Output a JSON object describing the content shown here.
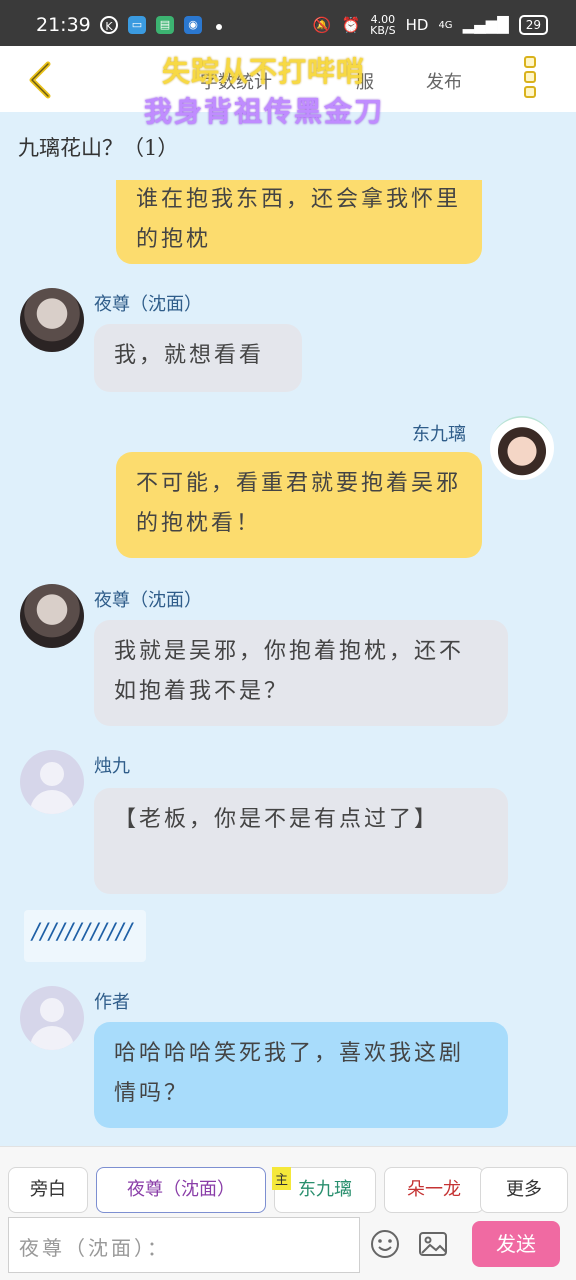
{
  "status_bar": {
    "time": "21:39",
    "speed": "4.00",
    "speed_unit": "KB/S",
    "network": "HD",
    "signal": "4G",
    "battery": "29"
  },
  "header": {
    "back_icon": "chevron-left-icon",
    "tab_stats": "字数统计",
    "tab_clothes": "服",
    "tab_publish": "发布",
    "overlay_line1": "失踪从不打哔哨",
    "overlay_line2": "我身背祖传黑金刀",
    "menu_icon": "more-vertical-icon"
  },
  "chat": {
    "title": "九璃花山？（1）",
    "messages": [
      {
        "side": "right",
        "text": "谁在抱我东西，还会拿我怀里的抱枕",
        "color": "yellow"
      },
      {
        "side": "left",
        "name": "夜尊（沈面）",
        "text": "我，就想看看",
        "avatar": "male"
      },
      {
        "side": "right",
        "name": "东九璃",
        "text": "不可能，看重君就要抱着吴邪的抱枕看！",
        "avatar": "female"
      },
      {
        "side": "left",
        "name": "夜尊（沈面）",
        "text": "我就是吴邪，你抱着抱枕，还不如抱着我不是？",
        "avatar": "male"
      },
      {
        "side": "left",
        "name": "烛九",
        "text": "【老板，你是不是有点过了】",
        "avatar": "default"
      },
      {
        "side": "left",
        "text": "////////////"
      },
      {
        "side": "left",
        "name": "作者",
        "text": "哈哈哈哈笑死我了，喜欢我这剧情吗？",
        "avatar": "default"
      }
    ]
  },
  "bottom": {
    "aside": "旁白",
    "role_active": "夜尊（沈面）",
    "main_tag": "主",
    "role_main": "东九璃",
    "role_other": "朵一龙",
    "more": "更多",
    "input_placeholder": "夜尊（沈面）：",
    "send": "发送"
  }
}
